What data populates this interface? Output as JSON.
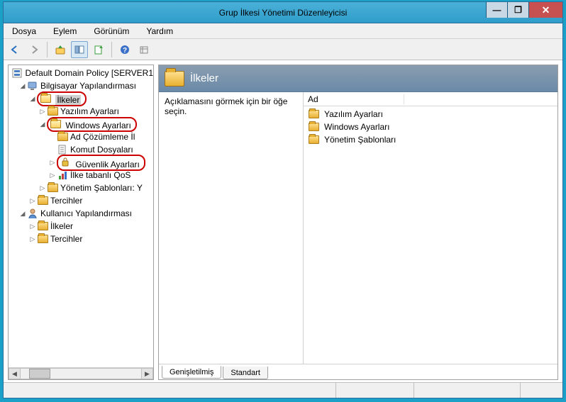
{
  "window": {
    "title": "Grup İlkesi Yönetimi Düzenleyicisi",
    "controls": {
      "min": "—",
      "max": "❐",
      "close": "✕"
    }
  },
  "menu": {
    "dosya": "Dosya",
    "eylem": "Eylem",
    "gorunum": "Görünüm",
    "yardim": "Yardım"
  },
  "tree": {
    "root": "Default Domain Policy [SERVER1",
    "bilgisayar": "Bilgisayar Yapılandırması",
    "ilkeler": "İlkeler",
    "yazilim": "Yazılım Ayarları",
    "windows": "Windows Ayarları",
    "adcozumleme": "Ad Çözümleme İl",
    "komut": "Komut Dosyaları",
    "guvenlik": "Güvenlik Ayarları",
    "qos": "İlke tabanlı QoS",
    "yonetim": "Yönetim Şablonları: Y",
    "tercihler": "Tercihler",
    "kullanici": "Kullanıcı Yapılandırması",
    "k_ilkeler": "İlkeler",
    "k_tercihler": "Tercihler"
  },
  "detail": {
    "title": "İlkeler",
    "description": "Açıklamasını görmek için bir öğe seçin.",
    "col_ad": "Ad",
    "items": {
      "0": "Yazılım Ayarları",
      "1": "Windows Ayarları",
      "2": "Yönetim Şablonları"
    },
    "tabs": {
      "genisletilmis": "Genişletilmiş",
      "standart": "Standart"
    }
  }
}
